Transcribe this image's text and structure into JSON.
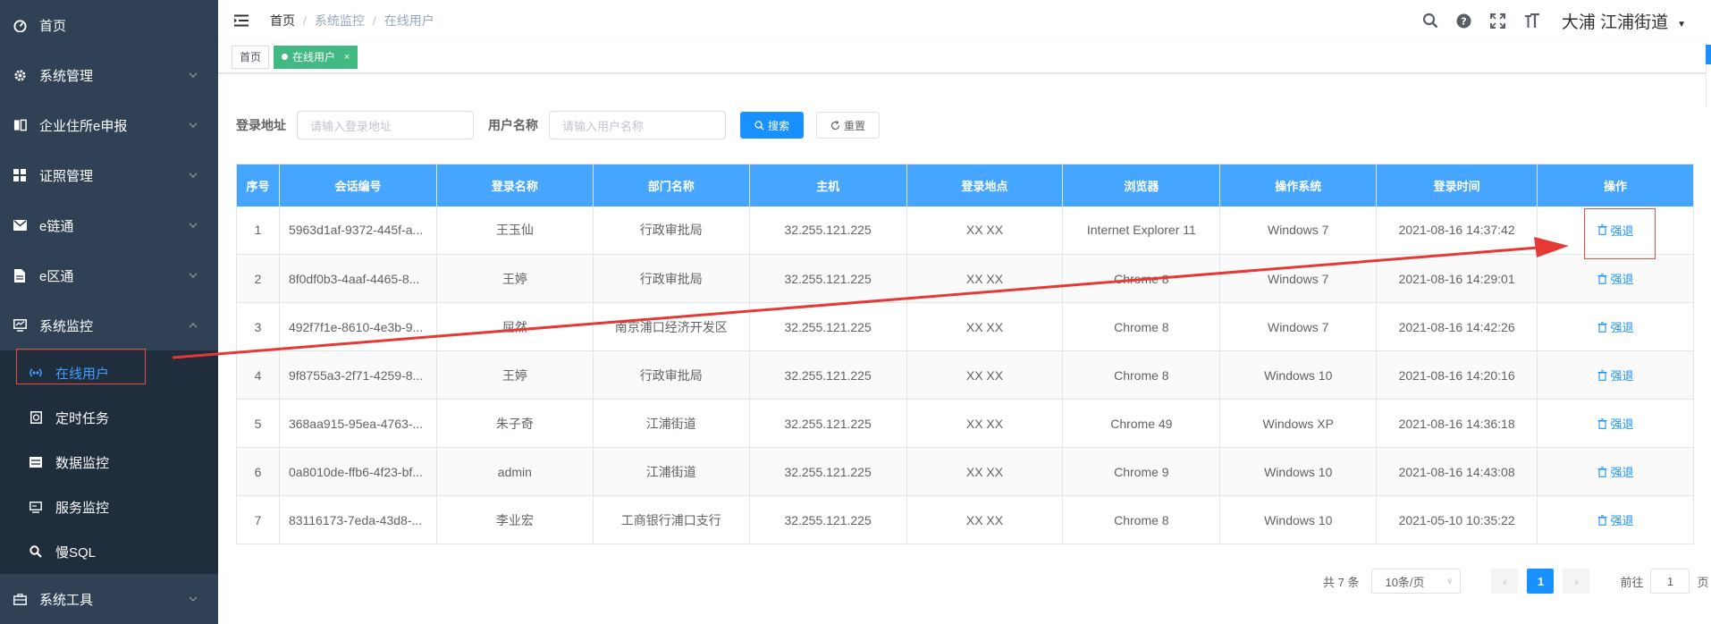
{
  "sidebar": {
    "items": [
      {
        "label": "首页",
        "icon": "dashboard-icon",
        "has_arrow": false
      },
      {
        "label": "系统管理",
        "icon": "gear-icon",
        "has_arrow": true
      },
      {
        "label": "企业住所e申报",
        "icon": "book-icon",
        "has_arrow": true
      },
      {
        "label": "证照管理",
        "icon": "grid-icon",
        "has_arrow": true
      },
      {
        "label": "e链通",
        "icon": "mail-icon",
        "has_arrow": true
      },
      {
        "label": "e区通",
        "icon": "document-icon",
        "has_arrow": true
      },
      {
        "label": "系统监控",
        "icon": "monitor-icon",
        "has_arrow": true,
        "expanded": true
      }
    ],
    "submenu": [
      {
        "label": "在线用户",
        "icon": "online-icon",
        "active": true
      },
      {
        "label": "定时任务",
        "icon": "clock-icon"
      },
      {
        "label": "数据监控",
        "icon": "database-icon"
      },
      {
        "label": "服务监控",
        "icon": "server-icon"
      },
      {
        "label": "慢SQL",
        "icon": "search-icon"
      }
    ],
    "last_item": {
      "label": "系统工具",
      "icon": "toolbox-icon",
      "has_arrow": true
    }
  },
  "navbar": {
    "breadcrumb": [
      "首页",
      "系统监控",
      "在线用户"
    ],
    "user_name": "大浦  江浦街道"
  },
  "tags": [
    {
      "label": "首页",
      "active": false
    },
    {
      "label": "在线用户",
      "active": true,
      "close": "×"
    }
  ],
  "search": {
    "ipaddr_label": "登录地址",
    "ipaddr_placeholder": "请输入登录地址",
    "username_label": "用户名称",
    "username_placeholder": "请输入用户名称",
    "search_button": "搜索",
    "reset_button": "重置"
  },
  "table": {
    "columns": [
      "序号",
      "会话编号",
      "登录名称",
      "部门名称",
      "主机",
      "登录地点",
      "浏览器",
      "操作系统",
      "登录时间",
      "操作"
    ],
    "rows": [
      {
        "no": "1",
        "session": "5963d1af-9372-445f-a...",
        "login": "王玉仙",
        "dept": "行政审批局",
        "host": "32.255.121.225",
        "location": "XX XX",
        "browser": "Internet Explorer 11",
        "os": "Windows 7",
        "time": "2021-08-16 14:37:42",
        "op": "强退"
      },
      {
        "no": "2",
        "session": "8f0df0b3-4aaf-4465-8...",
        "login": "王婷",
        "dept": "行政审批局",
        "host": "32.255.121.225",
        "location": "XX XX",
        "browser": "Chrome 8",
        "os": "Windows 7",
        "time": "2021-08-16 14:29:01",
        "op": "强退"
      },
      {
        "no": "3",
        "session": "492f7f1e-8610-4e3b-9...",
        "login": "屈然",
        "dept": "南京浦口经济开发区",
        "host": "32.255.121.225",
        "location": "XX XX",
        "browser": "Chrome 8",
        "os": "Windows 7",
        "time": "2021-08-16 14:42:26",
        "op": "强退"
      },
      {
        "no": "4",
        "session": "9f8755a3-2f71-4259-8...",
        "login": "王婷",
        "dept": "行政审批局",
        "host": "32.255.121.225",
        "location": "XX XX",
        "browser": "Chrome 8",
        "os": "Windows 10",
        "time": "2021-08-16 14:20:16",
        "op": "强退"
      },
      {
        "no": "5",
        "session": "368aa915-95ea-4763-...",
        "login": "朱子奇",
        "dept": "江浦街道",
        "host": "32.255.121.225",
        "location": "XX XX",
        "browser": "Chrome 49",
        "os": "Windows XP",
        "time": "2021-08-16 14:36:18",
        "op": "强退"
      },
      {
        "no": "6",
        "session": "0a8010de-ffb6-4f23-bf...",
        "login": "admin",
        "dept": "江浦街道",
        "host": "32.255.121.225",
        "location": "XX XX",
        "browser": "Chrome 9",
        "os": "Windows 10",
        "time": "2021-08-16 14:43:08",
        "op": "强退"
      },
      {
        "no": "7",
        "session": "83116173-7eda-43d8-...",
        "login": "李业宏",
        "dept": "工商银行浦口支行",
        "host": "32.255.121.225",
        "location": "XX XX",
        "browser": "Chrome 8",
        "os": "Windows 10",
        "time": "2021-05-10 10:35:22",
        "op": "强退"
      }
    ]
  },
  "pagination": {
    "total": "共 7 条",
    "page_size": "10条/页",
    "current": "1",
    "goto_prefix": "前往",
    "goto_value": "1",
    "goto_suffix": "页"
  },
  "colors": {
    "sidebar_bg": "#304156",
    "submenu_bg": "#1f2d3d",
    "accent": "#1890ff",
    "table_header": "#46a6ff",
    "tag_active": "#42b983",
    "annotation": "#e74c3c"
  }
}
